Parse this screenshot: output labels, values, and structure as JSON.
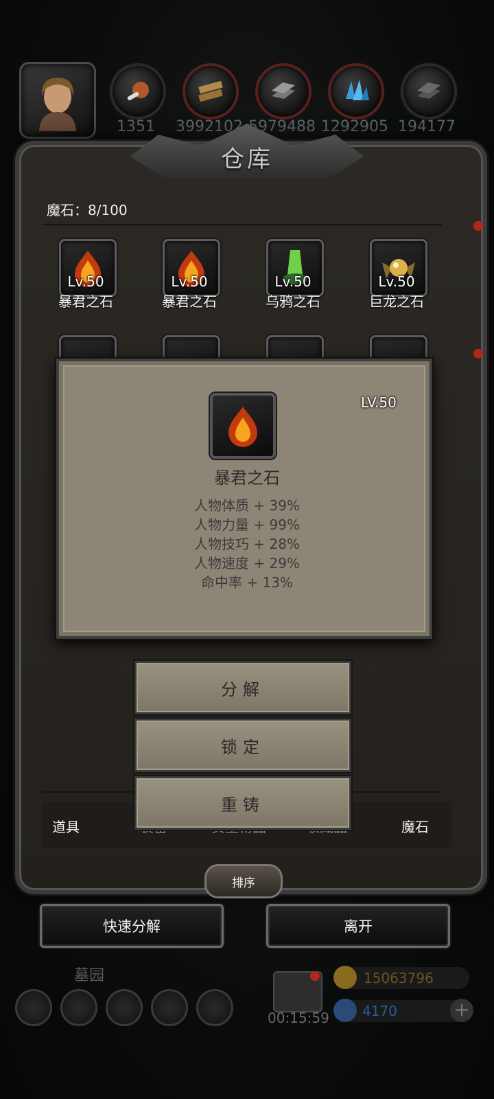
{
  "resources": [
    "1351",
    "3992102",
    "5979488",
    "1292905",
    "194177"
  ],
  "warehouse": {
    "title": "仓库",
    "count_label": "魔石：8/100",
    "items": [
      {
        "name": "暴君之石",
        "level": "Lv.50"
      },
      {
        "name": "暴君之石",
        "level": "Lv.50"
      },
      {
        "name": "乌鸦之石",
        "level": "Lv.50"
      },
      {
        "name": "巨龙之石",
        "level": "Lv.50"
      }
    ]
  },
  "detail": {
    "level": "LV.50",
    "name": "暴君之石",
    "stats": [
      "人物体质 + 39%",
      "人物力量 + 99%",
      "人物技巧 + 28%",
      "人物速度 + 29%",
      "命中率 + 13%"
    ]
  },
  "actions": {
    "decompose": "分解",
    "lock": "锁定",
    "reforge": "重铸"
  },
  "tabs": [
    "道具",
    "装备",
    "贵重物品",
    "收藏品",
    "魔石"
  ],
  "sort_label": "排序",
  "quick_decompose": "快速分解",
  "leave": "离开",
  "hud": {
    "location": "墓园",
    "timer": "00:15:59",
    "gold": "15063796",
    "gems": "4170"
  },
  "colors": {
    "gold": "#b08a2e",
    "gems": "#3a7bd5",
    "red_dot": "#b3261e"
  }
}
